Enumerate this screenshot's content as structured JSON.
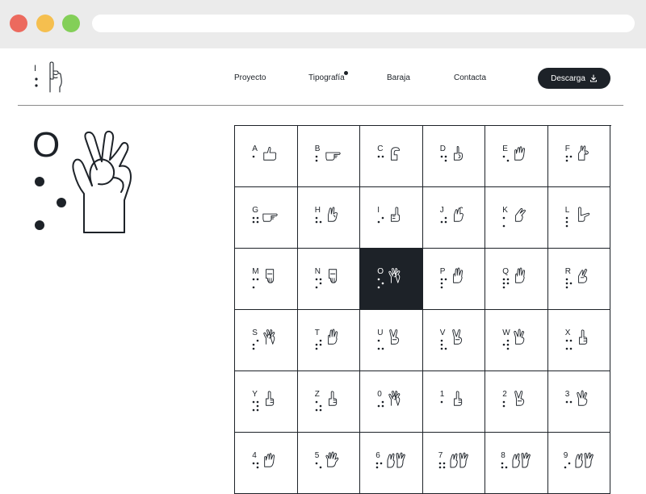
{
  "nav": {
    "links": [
      "Proyecto",
      "Tipografía",
      "Baraja",
      "Contacta"
    ],
    "download_label": "Descarga"
  },
  "logo": {
    "char": "I"
  },
  "featured": {
    "char": "O",
    "braille": [
      1,
      3,
      5
    ]
  },
  "grid": {
    "active_index": 14,
    "cells": [
      {
        "char": "A",
        "braille": [
          1
        ],
        "hand": "thumb-side"
      },
      {
        "char": "B",
        "braille": [
          1,
          2
        ],
        "hand": "point-right"
      },
      {
        "char": "C",
        "braille": [
          1,
          4
        ],
        "hand": "c-shape"
      },
      {
        "char": "D",
        "braille": [
          1,
          4,
          5
        ],
        "hand": "d-shape"
      },
      {
        "char": "E",
        "braille": [
          1,
          5
        ],
        "hand": "four-fingers"
      },
      {
        "char": "F",
        "braille": [
          1,
          2,
          4
        ],
        "hand": "f-shape"
      },
      {
        "char": "G",
        "braille": [
          1,
          2,
          4,
          5
        ],
        "hand": "point-right"
      },
      {
        "char": "H",
        "braille": [
          1,
          2,
          5
        ],
        "hand": "h-shape"
      },
      {
        "char": "I",
        "braille": [
          2,
          4
        ],
        "hand": "pinky-up"
      },
      {
        "char": "J",
        "braille": [
          2,
          4,
          5
        ],
        "hand": "j-shape"
      },
      {
        "char": "K",
        "braille": [
          1,
          3
        ],
        "hand": "k-shape"
      },
      {
        "char": "L",
        "braille": [
          1,
          2,
          3
        ],
        "hand": "l-shape"
      },
      {
        "char": "M",
        "braille": [
          1,
          3,
          4
        ],
        "hand": "fist-down"
      },
      {
        "char": "N",
        "braille": [
          1,
          3,
          4,
          5
        ],
        "hand": "fist-down"
      },
      {
        "char": "O",
        "braille": [
          1,
          3,
          5
        ],
        "hand": "ok-sign"
      },
      {
        "char": "P",
        "braille": [
          1,
          2,
          3,
          4
        ],
        "hand": "open-fingers"
      },
      {
        "char": "Q",
        "braille": [
          1,
          2,
          3,
          4,
          5
        ],
        "hand": "open-fingers"
      },
      {
        "char": "R",
        "braille": [
          1,
          2,
          3,
          5
        ],
        "hand": "crossed-fingers"
      },
      {
        "char": "S",
        "braille": [
          2,
          3,
          4
        ],
        "hand": "ok-sign"
      },
      {
        "char": "T",
        "braille": [
          2,
          3,
          4,
          5
        ],
        "hand": "open-fingers"
      },
      {
        "char": "U",
        "braille": [
          1,
          3,
          6
        ],
        "hand": "v-sign"
      },
      {
        "char": "V",
        "braille": [
          1,
          2,
          3,
          6
        ],
        "hand": "v-sign"
      },
      {
        "char": "W",
        "braille": [
          2,
          4,
          5,
          6
        ],
        "hand": "three-fingers"
      },
      {
        "char": "X",
        "braille": [
          1,
          3,
          4,
          6
        ],
        "hand": "index-up"
      },
      {
        "char": "Y",
        "braille": [
          1,
          3,
          4,
          5,
          6
        ],
        "hand": "index-up"
      },
      {
        "char": "Z",
        "braille": [
          1,
          3,
          5,
          6
        ],
        "hand": "index-up"
      },
      {
        "char": "0",
        "braille": [
          2,
          4,
          5
        ],
        "hand": "ok-sign"
      },
      {
        "char": "1",
        "braille": [
          1
        ],
        "hand": "index-up"
      },
      {
        "char": "2",
        "braille": [
          1,
          2
        ],
        "hand": "v-sign"
      },
      {
        "char": "3",
        "braille": [
          1,
          4
        ],
        "hand": "three-fingers"
      },
      {
        "char": "4",
        "braille": [
          1,
          4,
          5
        ],
        "hand": "four-fingers"
      },
      {
        "char": "5",
        "braille": [
          1,
          5
        ],
        "hand": "open-hand"
      },
      {
        "char": "6",
        "braille": [
          1,
          2,
          4
        ],
        "hand": "two-hands"
      },
      {
        "char": "7",
        "braille": [
          1,
          2,
          4,
          5
        ],
        "hand": "two-hands"
      },
      {
        "char": "8",
        "braille": [
          1,
          2,
          5
        ],
        "hand": "two-hands"
      },
      {
        "char": "9",
        "braille": [
          2,
          4
        ],
        "hand": "two-hands"
      }
    ]
  }
}
